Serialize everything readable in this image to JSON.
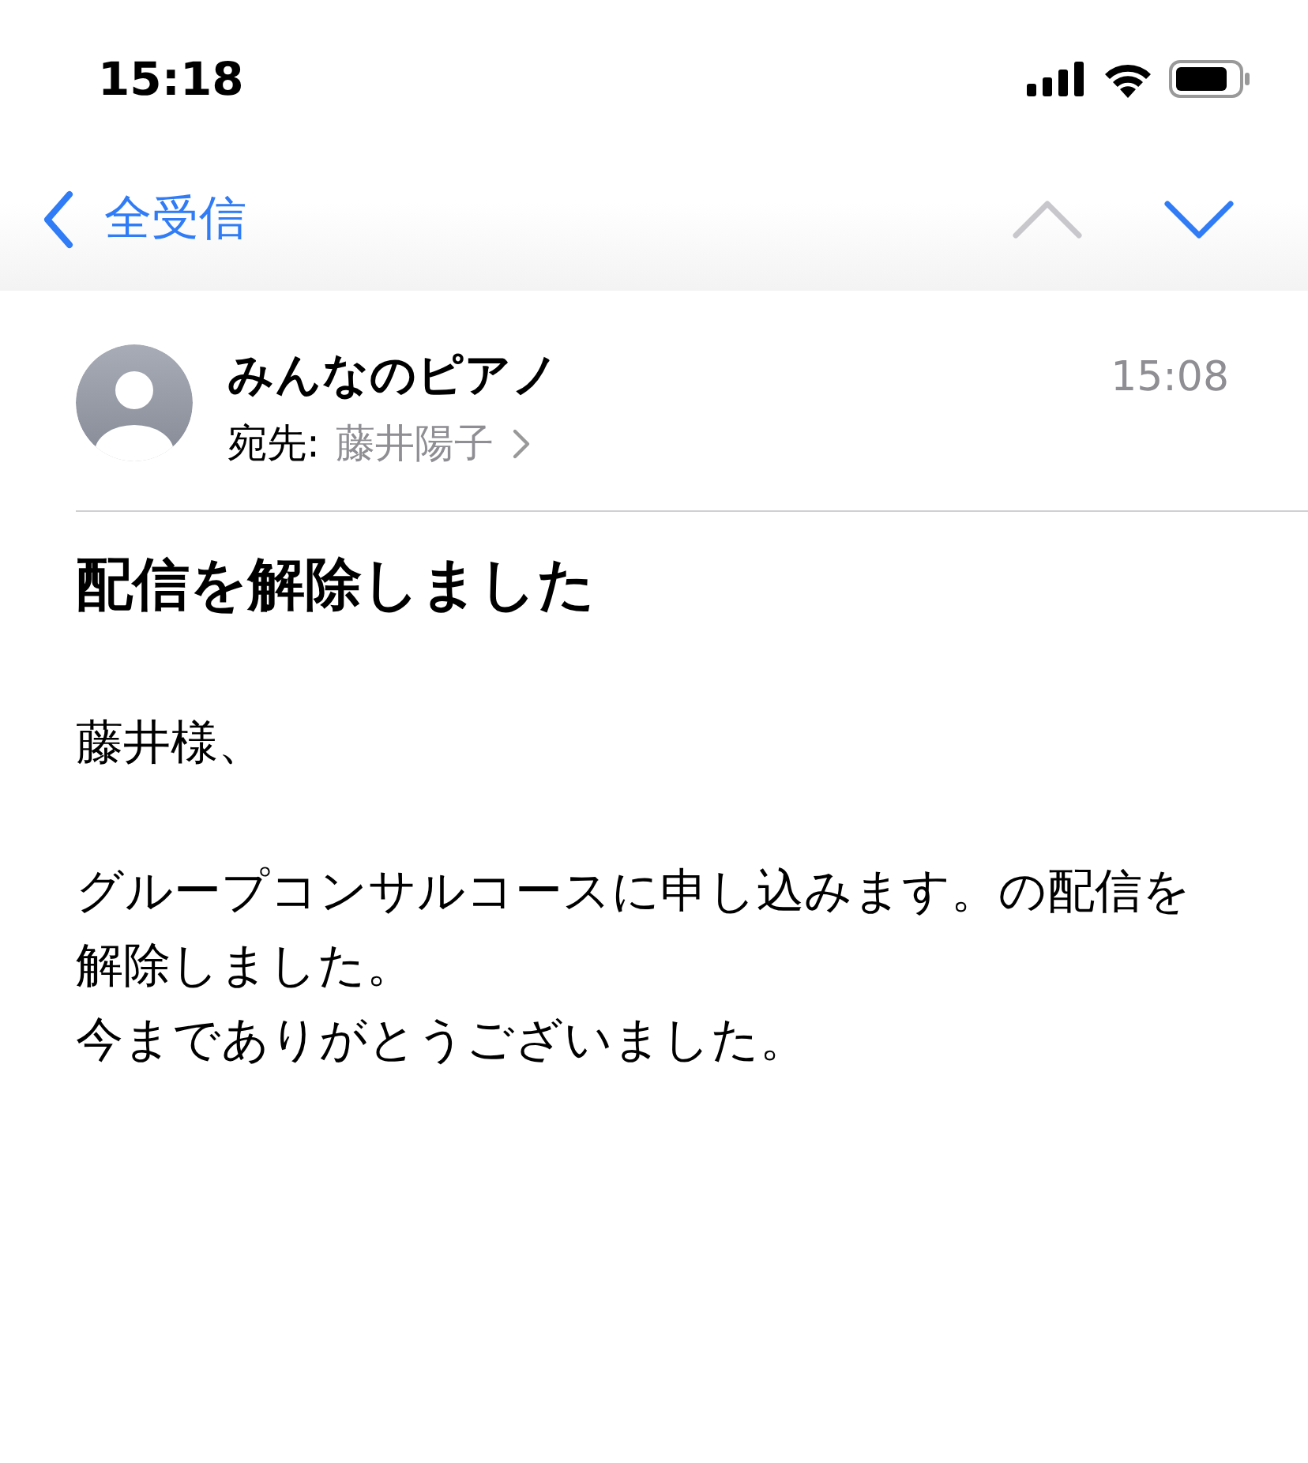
{
  "status_bar": {
    "time": "15:18"
  },
  "nav": {
    "back_label": "全受信",
    "previous_disabled": true,
    "next_disabled": false
  },
  "message": {
    "sender": "みんなのピアノ",
    "time": "15:08",
    "to_label": "宛先:",
    "recipient": "藤井陽子",
    "subject": "配信を解除しました",
    "paragraphs": [
      {
        "lines": [
          "藤井様、"
        ]
      },
      {
        "lines": [
          "グループコンサルコースに申し込みます。の配信を解除しました。",
          "今までありがとうございました。"
        ]
      }
    ]
  }
}
